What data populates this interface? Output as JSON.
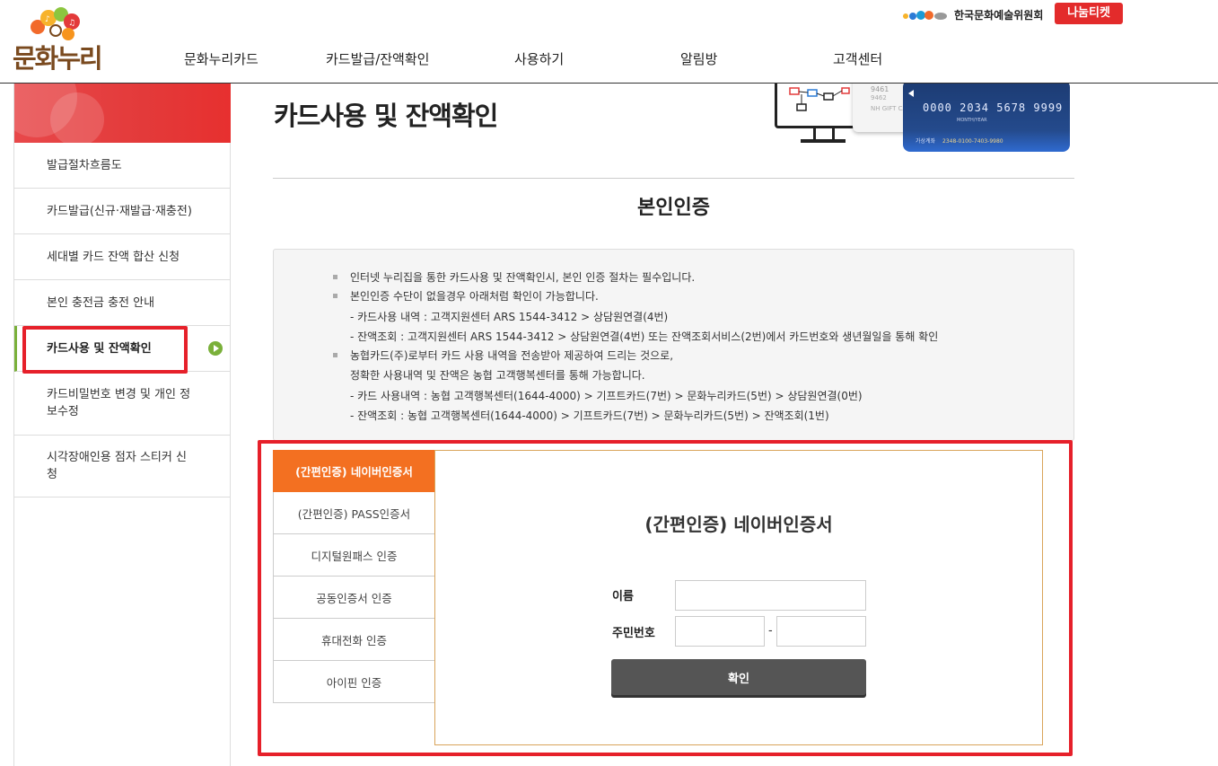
{
  "brand": {
    "logo_text": "문화누리",
    "org_name": "한국문화예술위원회",
    "ticket_label": "나눔티켓"
  },
  "gnb": [
    {
      "label": "문화누리카드"
    },
    {
      "label": "카드발급/잔액확인"
    },
    {
      "label": "사용하기"
    },
    {
      "label": "알림방"
    },
    {
      "label": "고객센터"
    }
  ],
  "sidebar": {
    "items": [
      {
        "label": "발급절차흐름도"
      },
      {
        "label": "카드발급(신규·재발급·재충전)"
      },
      {
        "label": "세대별 카드 잔액 합산 신청"
      },
      {
        "label": "본인 충전금 충전 안내"
      },
      {
        "label": "카드사용 및 잔액확인",
        "active": true
      },
      {
        "label": "카드비밀번호 변경 및 개인 정보수정"
      },
      {
        "label": "시각장애인용 점자 스티커 신청"
      }
    ]
  },
  "page": {
    "title": "카드사용 및 잔액확인",
    "section_title": "본인인증"
  },
  "hero": {
    "card_number": "0000 2034 5678 9999",
    "card_white_num": "9461",
    "card_white_sub": "9462",
    "card_white_label": "NH GIFT CA",
    "card_sub": "MONTH/YEAR",
    "card_account_label": "가상계좌",
    "card_account": "2348-0100-7403-9980"
  },
  "notice": {
    "lines": [
      {
        "text": "인터넷 누리집을 통한 카드사용 및 잔액확인시, 본인 인증 절차는 필수입니다.",
        "bullet": true
      },
      {
        "text": "본인인증 수단이 없을경우 아래처럼 확인이 가능합니다.",
        "bullet": true
      },
      {
        "text": "- 카드사용 내역 : 고객지원센터 ARS 1544-3412 > 상담원연결(4번)",
        "bullet": false
      },
      {
        "text": "- 잔액조회 : 고객지원센터 ARS 1544-3412 > 상담원연결(4번) 또는 잔액조회서비스(2번)에서 카드번호와 생년월일을 통해 확인",
        "bullet": false
      },
      {
        "text": "농협카드(주)로부터 카드 사용 내역을 전송받아 제공하여 드리는 것으로,",
        "bullet": true
      },
      {
        "text": "정확한 사용내역 및 잔액은 농협 고객행복센터를 통해 가능합니다.",
        "bullet": false
      },
      {
        "text": "- 카드 사용내역 : 농협 고객행복센터(1644-4000) > 기프트카드(7번) > 문화누리카드(5번) > 상담원연결(0번)",
        "bullet": false
      },
      {
        "text": "- 잔액조회 : 농협 고객행복센터(1644-4000) > 기프트카드(7번) > 문화누리카드(5번) > 잔액조회(1번)",
        "bullet": false
      }
    ]
  },
  "auth": {
    "tabs": [
      {
        "label": "(간편인증) 네이버인증서",
        "active": true
      },
      {
        "label": "(간편인증) PASS인증서"
      },
      {
        "label": "디지털원패스 인증"
      },
      {
        "label": "공동인증서 인증"
      },
      {
        "label": "휴대전화 인증"
      },
      {
        "label": "아이핀 인증"
      }
    ],
    "panel_title": "(간편인증) 네이버인증서",
    "name_label": "이름",
    "name_value": "",
    "rrn_label": "주민번호",
    "rrn_front_value": "",
    "rrn_back_value": "",
    "rrn_separator": "-",
    "confirm_label": "확인"
  },
  "colors": {
    "accent_orange": "#f37021",
    "highlight_red": "#e6202a",
    "active_green": "#7ab03a",
    "button_gray": "#555555"
  }
}
